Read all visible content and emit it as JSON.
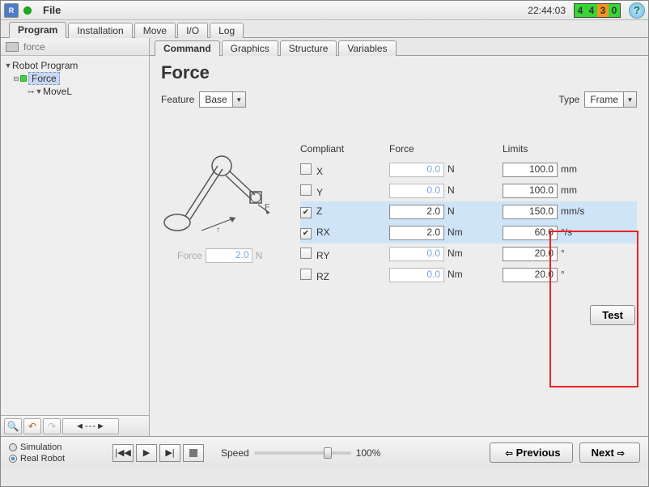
{
  "menubar": {
    "file": "File",
    "clock": "22:44:03",
    "digits": [
      "4",
      "4",
      "3",
      "0"
    ],
    "digit_colors": [
      "#37d637",
      "#37d637",
      "#f7931e",
      "#37d637"
    ],
    "help": "?"
  },
  "main_tabs": [
    {
      "label": "Program",
      "active": true
    },
    {
      "label": "Installation",
      "active": false
    },
    {
      "label": "Move",
      "active": false
    },
    {
      "label": "I/O",
      "active": false
    },
    {
      "label": "Log",
      "active": false
    }
  ],
  "file": {
    "name": "force"
  },
  "tree": {
    "root": "Robot Program",
    "force": "Force",
    "movel": "MoveL"
  },
  "toolbar": {
    "nav": "◄---►"
  },
  "sub_tabs": [
    {
      "label": "Command",
      "active": true
    },
    {
      "label": "Graphics",
      "active": false
    },
    {
      "label": "Structure",
      "active": false
    },
    {
      "label": "Variables",
      "active": false
    }
  ],
  "panel": {
    "title": "Force",
    "feature_label": "Feature",
    "feature_value": "Base",
    "type_label": "Type",
    "type_value": "Frame",
    "illus_force_label": "Force",
    "illus_force_value": "2.0",
    "illus_force_unit": "N",
    "headers": {
      "compliant": "Compliant",
      "force": "Force",
      "limits": "Limits"
    },
    "rows": [
      {
        "axis": "X",
        "checked": false,
        "force": "0.0",
        "funit": "N",
        "limit": "100.0",
        "lunit": "mm",
        "hl": false
      },
      {
        "axis": "Y",
        "checked": false,
        "force": "0.0",
        "funit": "N",
        "limit": "100.0",
        "lunit": "mm",
        "hl": false
      },
      {
        "axis": "Z",
        "checked": true,
        "force": "2.0",
        "funit": "N",
        "limit": "150.0",
        "lunit": "mm/s",
        "hl": true
      },
      {
        "axis": "RX",
        "checked": true,
        "force": "2.0",
        "funit": "Nm",
        "limit": "60.0",
        "lunit": "°/s",
        "hl": true
      },
      {
        "axis": "RY",
        "checked": false,
        "force": "0.0",
        "funit": "Nm",
        "limit": "20.0",
        "lunit": "°",
        "hl": false
      },
      {
        "axis": "RZ",
        "checked": false,
        "force": "0.0",
        "funit": "Nm",
        "limit": "20.0",
        "lunit": "°",
        "hl": false
      }
    ],
    "test_label": "Test"
  },
  "bottom": {
    "sim": "Simulation",
    "real": "Real Robot",
    "speed_label": "Speed",
    "speed_value": "100%",
    "prev": "Previous",
    "next": "Next"
  }
}
